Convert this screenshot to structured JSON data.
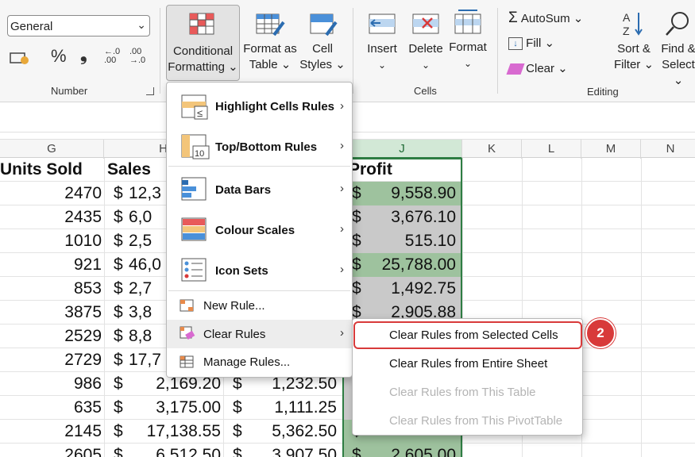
{
  "ribbon": {
    "number_format": "General",
    "number_group_label": "Number",
    "cells_group_label": "Cells",
    "editing_group_label": "Editing",
    "accounting_icon": "accounting-format-icon",
    "percent_symbol": "%",
    "comma_symbol": "❟",
    "conditional_formatting": [
      "Conditional",
      "Formatting ⌄"
    ],
    "format_as_table": [
      "Format as",
      "Table ⌄"
    ],
    "cell_styles": [
      "Cell",
      "Styles ⌄"
    ],
    "insert": "Insert",
    "delete": "Delete",
    "format": "Format",
    "autosum": "AutoSum ⌄",
    "fill": "Fill ⌄",
    "clear": "Clear ⌄",
    "sort_filter": [
      "Sort &",
      "Filter ⌄"
    ],
    "find_select": [
      "Find &",
      "Select ⌄"
    ]
  },
  "sheet": {
    "columns": [
      "G",
      "H",
      "J",
      "K",
      "L",
      "M",
      "N"
    ],
    "headers": {
      "units_sold": "Units Sold",
      "sales": "Sales",
      "profit": "Profit"
    },
    "rows": [
      {
        "units": "2470",
        "sales": "12,3",
        "prof": "",
        "profit": "9,558.90",
        "green": true
      },
      {
        "units": "2435",
        "sales": "6,0",
        "prof": "",
        "profit": "3,676.10",
        "green": false
      },
      {
        "units": "1010",
        "sales": "2,5",
        "prof": "",
        "profit": "515.10",
        "green": false
      },
      {
        "units": "921",
        "sales": "46,0",
        "prof": "",
        "profit": "25,788.00",
        "green": true
      },
      {
        "units": "853",
        "sales": "2,7",
        "prof": "",
        "profit": "1,492.75",
        "green": false
      },
      {
        "units": "3875",
        "sales": "3,8",
        "prof": "",
        "profit": "2,905.88",
        "green": false
      },
      {
        "units": "2529",
        "sales": "8,8",
        "prof": "",
        "profit": "",
        "green": false
      },
      {
        "units": "2729",
        "sales": "17,7",
        "prof": "",
        "profit": "",
        "green": false
      },
      {
        "units": "986",
        "sales": "2,169.20",
        "prof": "1,232.50",
        "profit": "",
        "green": false
      },
      {
        "units": "635",
        "sales": "3,175.00",
        "prof": "1,111.25",
        "profit": "",
        "green": false
      },
      {
        "units": "2145",
        "sales": "17,138.55",
        "prof": "5,362.50",
        "profit": "",
        "green": true
      },
      {
        "units": "2605",
        "sales": "6,512.50",
        "prof": "3,907.50",
        "profit": "2,605.00",
        "green": true
      }
    ],
    "currency": "$"
  },
  "cf_menu": {
    "items": [
      {
        "label": "Highlight Cells Rules",
        "icon": "highlight-cells-icon"
      },
      {
        "label": "Top/Bottom Rules",
        "icon": "top-bottom-icon"
      },
      {
        "label": "Data Bars",
        "icon": "data-bars-icon"
      },
      {
        "label": "Colour Scales",
        "icon": "colour-scales-icon"
      },
      {
        "label": "Icon Sets",
        "icon": "icon-sets-icon"
      }
    ],
    "new_rule": "New Rule...",
    "clear_rules": "Clear Rules",
    "manage_rules": "Manage Rules..."
  },
  "clear_submenu": {
    "items": [
      {
        "label": "Clear Rules from Selected Cells",
        "enabled": true
      },
      {
        "label": "Clear Rules from Entire Sheet",
        "enabled": true
      },
      {
        "label": "Clear Rules from This Table",
        "enabled": false
      },
      {
        "label": "Clear Rules from This PivotTable",
        "enabled": false
      }
    ]
  },
  "annotation": {
    "badge": "2",
    "color": "#d83a3a"
  },
  "colors": {
    "selection_green": "#2e7d43",
    "green_fill": "#9ec29e",
    "gray_fill": "#c9c9c9"
  }
}
